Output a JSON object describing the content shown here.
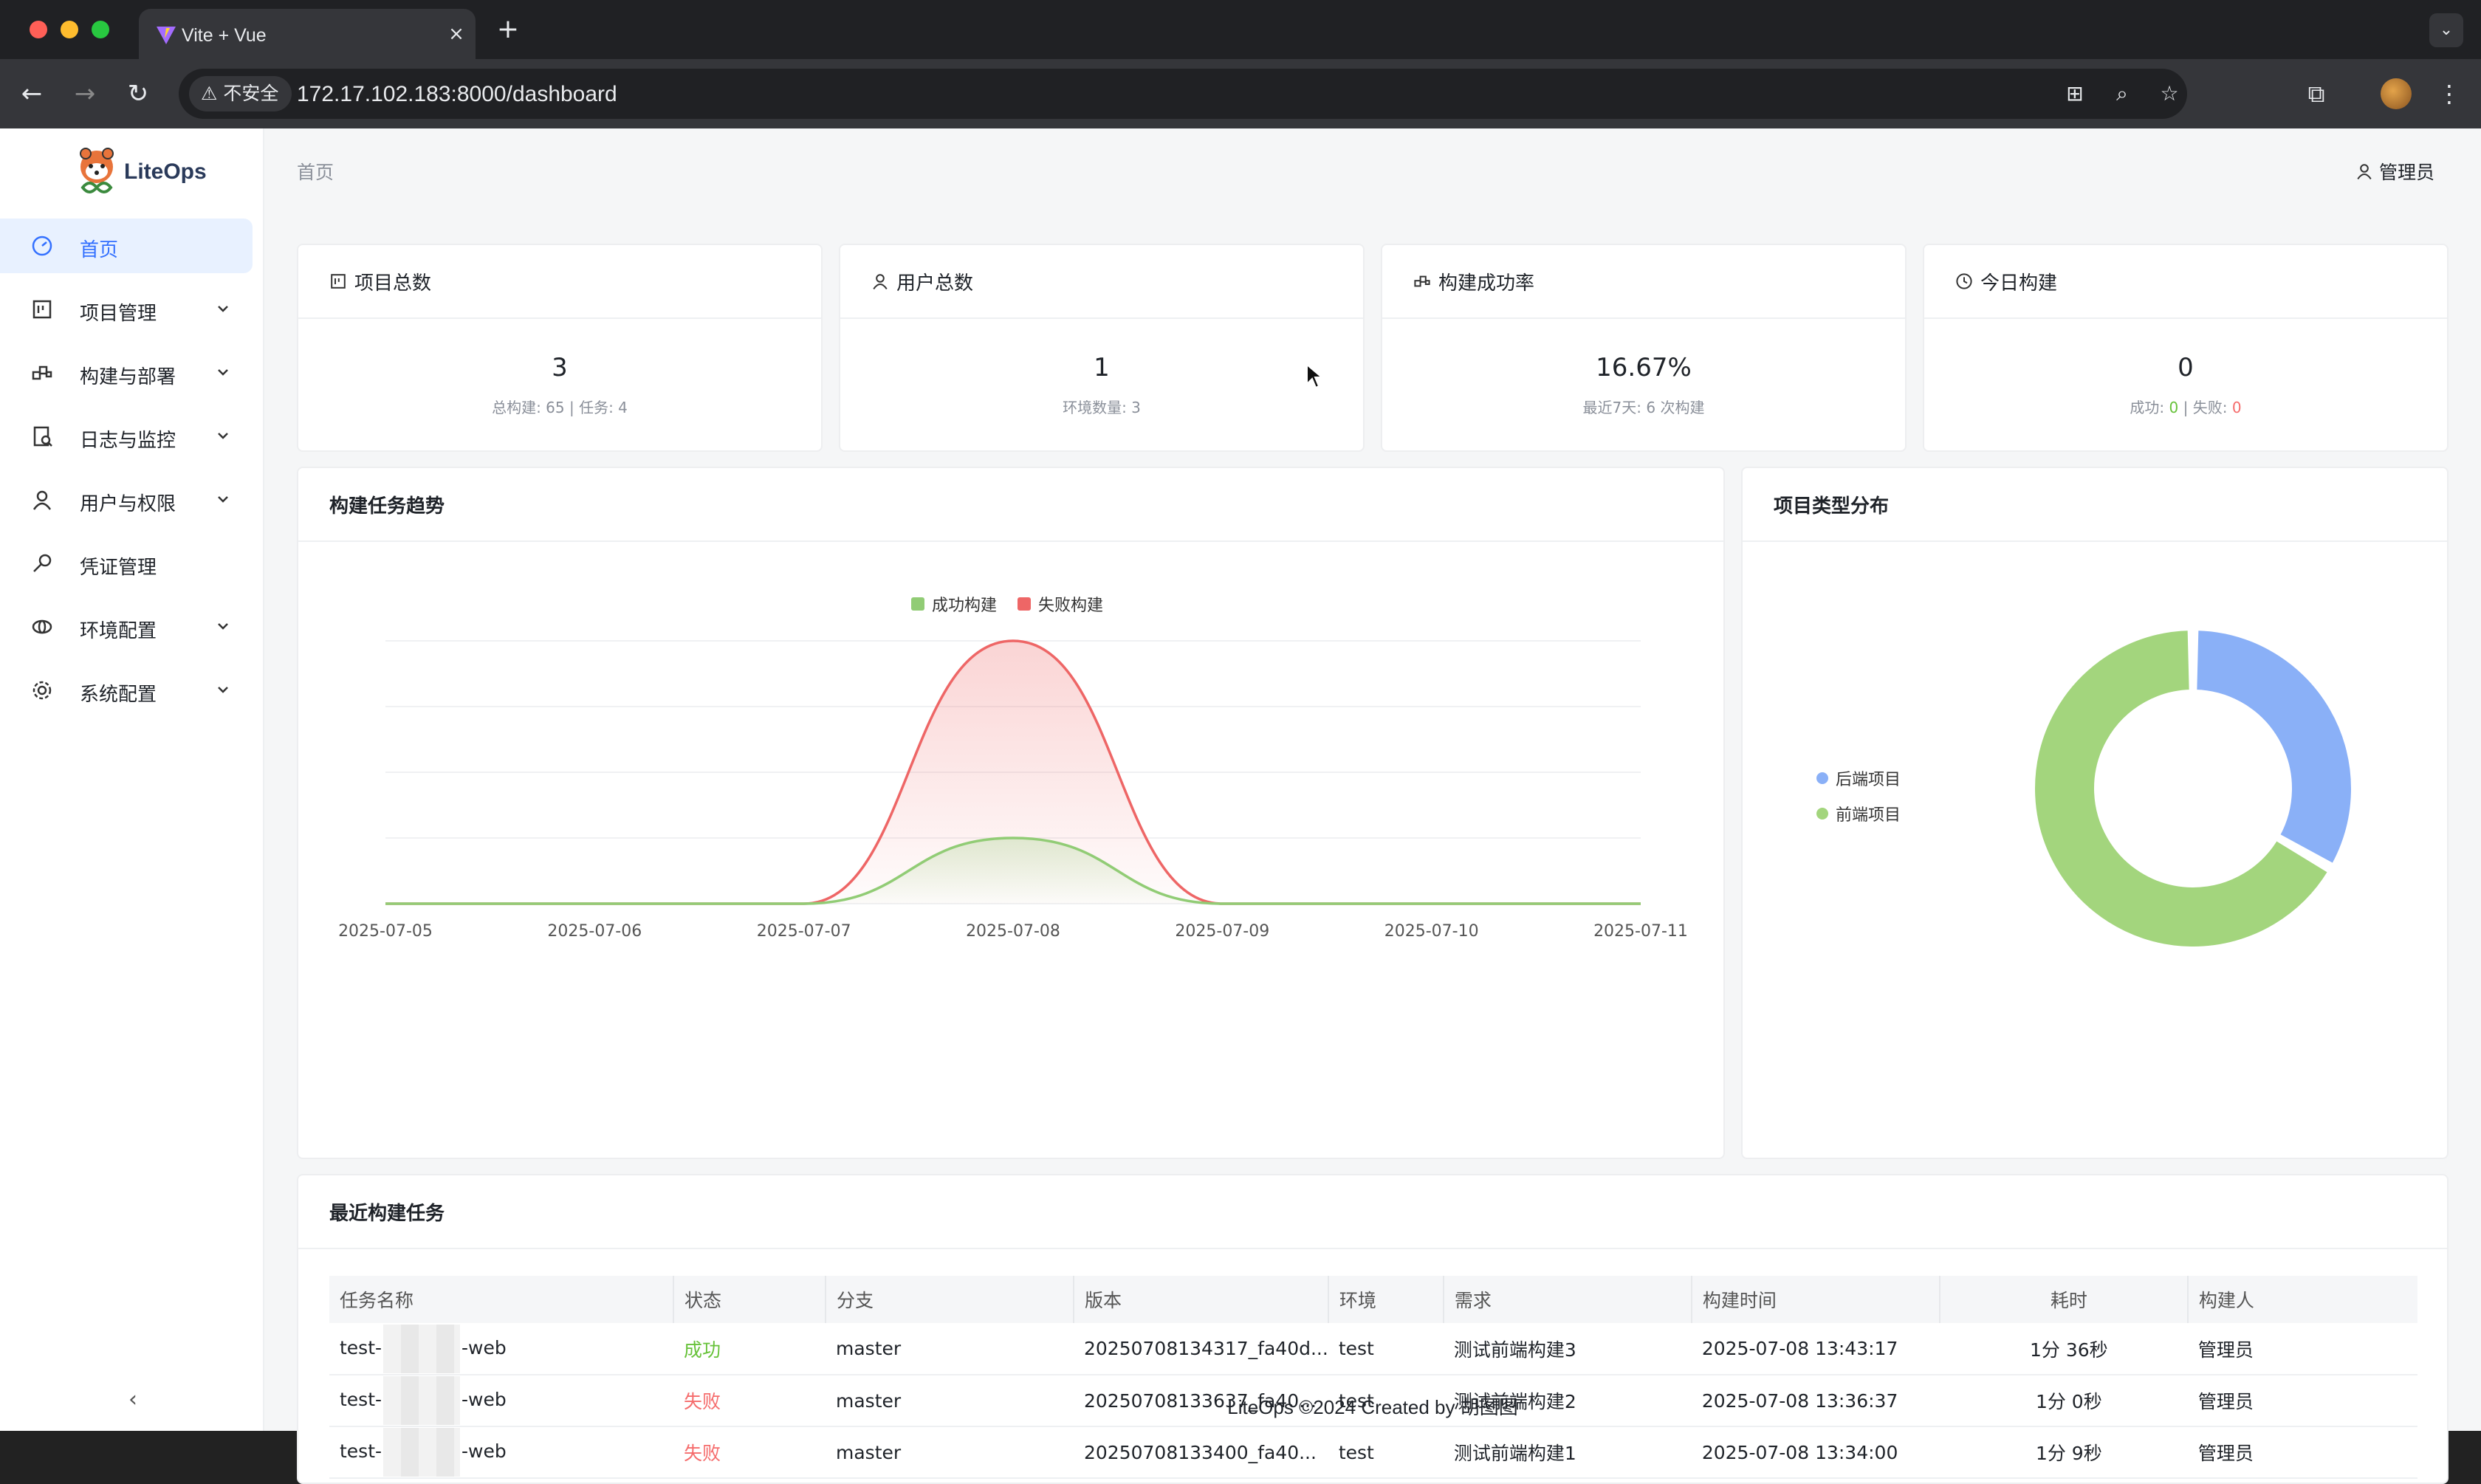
{
  "browser": {
    "tab_title": "Vite + Vue",
    "tab_close": "×",
    "new_tab": "+",
    "security_label": "不安全",
    "url": "172.17.102.183:8000/dashboard"
  },
  "app": {
    "logo_text": "LiteOps",
    "breadcrumb": "首页",
    "user_label": "管理员"
  },
  "sidebar": {
    "items": [
      {
        "label": "首页",
        "icon": "dashboard-icon",
        "active": true
      },
      {
        "label": "项目管理",
        "icon": "project-icon"
      },
      {
        "label": "构建与部署",
        "icon": "build-icon"
      },
      {
        "label": "日志与监控",
        "icon": "log-icon"
      },
      {
        "label": "用户与权限",
        "icon": "user-icon"
      },
      {
        "label": "凭证管理",
        "icon": "key-icon"
      },
      {
        "label": "环境配置",
        "icon": "environment-icon"
      },
      {
        "label": "系统配置",
        "icon": "settings-icon"
      }
    ]
  },
  "stats": [
    {
      "title": "项目总数",
      "value": "3",
      "sub": "总构建: 65 | 任务: 4"
    },
    {
      "title": "用户总数",
      "value": "1",
      "sub": "环境数量: 3"
    },
    {
      "title": "构建成功率",
      "value": "16.67%",
      "sub": "最近7天: 6 次构建"
    },
    {
      "title": "今日构建",
      "value": "0",
      "sub_success_label": "成功: ",
      "sub_success_value": "0",
      "sub_sep": " | 失败: ",
      "sub_fail_value": "0"
    }
  ],
  "trend": {
    "title": "构建任务趋势"
  },
  "distribution": {
    "title": "项目类型分布"
  },
  "chart_data": [
    {
      "type": "area",
      "x": [
        "2025-07-05",
        "2025-07-06",
        "2025-07-07",
        "2025-07-08",
        "2025-07-09",
        "2025-07-10",
        "2025-07-11"
      ],
      "series": [
        {
          "name": "成功构建",
          "values": [
            0,
            0,
            0,
            1,
            0,
            0,
            0
          ],
          "color": "#91cc75"
        },
        {
          "name": "失败构建",
          "values": [
            0,
            0,
            0,
            4,
            0,
            0,
            0
          ],
          "color": "#ee6666"
        }
      ],
      "smooth": true,
      "grid": true,
      "legend": "top-center"
    },
    {
      "type": "pie",
      "donut": true,
      "labels": [
        "后端项目",
        "前端项目"
      ],
      "values": [
        1,
        2
      ],
      "colors": [
        "#8ab0f7",
        "#a3d57d"
      ],
      "legend": "left"
    }
  ],
  "recent": {
    "title": "最近构建任务",
    "columns": [
      "任务名称",
      "状态",
      "分支",
      "版本",
      "环境",
      "需求",
      "构建时间",
      "耗时",
      "构建人"
    ],
    "rows": [
      {
        "name_prefix": "test-",
        "name_suffix": "-web",
        "status": "成功",
        "status_type": "ok",
        "branch": "master",
        "version": "20250708134317_fa40d...",
        "env": "test",
        "req": "测试前端构建3",
        "time": "2025-07-08 13:43:17",
        "duration": "1分 36秒",
        "user": "管理员"
      },
      {
        "name_prefix": "test-",
        "name_suffix": "-web",
        "status": "失败",
        "status_type": "bad",
        "branch": "master",
        "version": "20250708133637_fa40...",
        "env": "test",
        "req": "测试前端构建2",
        "time": "2025-07-08 13:36:37",
        "duration": "1分 0秒",
        "user": "管理员"
      },
      {
        "name_prefix": "test-",
        "name_suffix": "-web",
        "status": "失败",
        "status_type": "bad",
        "branch": "master",
        "version": "20250708133400_fa40...",
        "env": "test",
        "req": "测试前端构建1",
        "time": "2025-07-08 13:34:00",
        "duration": "1分 9秒",
        "user": "管理员"
      }
    ]
  },
  "footer": "LiteOps ©2024 Created by 胡图图",
  "colors": {
    "accent": "#3370ff",
    "success": "#67c23a",
    "fail": "#f56c6c"
  }
}
